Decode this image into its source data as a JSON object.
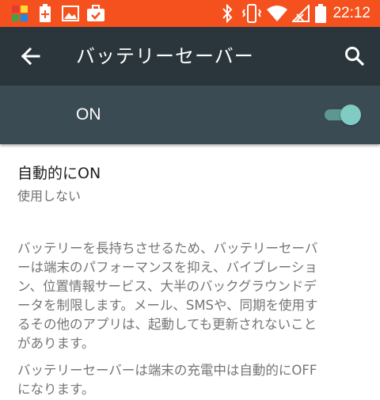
{
  "status_bar": {
    "time": "22:12",
    "background": "#f4511e",
    "left_icons": [
      "app-grid-icon",
      "battery-plus-icon",
      "image-icon",
      "briefcase-icon"
    ],
    "right_icons": [
      "bluetooth-icon",
      "vibrate-icon",
      "wifi-icon",
      "no-signal-icon",
      "battery-icon"
    ]
  },
  "app_bar": {
    "title": "バッテリーセーバー",
    "back_icon": "arrow-left-icon",
    "search_icon": "search-icon",
    "background": "#2b363c"
  },
  "master_switch": {
    "label": "ON",
    "checked": true,
    "background": "#3b4b53",
    "accent": "#80cbc4"
  },
  "auto_on": {
    "title": "自動的にON",
    "value": "使用しない"
  },
  "description": {
    "paragraph1_lines": [
      "バッテリーを長持ちさせるため、バッテリーセーバ",
      "ーは端末のパフォーマンスを抑え、バイブレーショ",
      "ン、位置情報サービス、大半のバックグラウンドデ",
      "ータを制限します。メール、SMSや、同期を使用す",
      "るその他のアプリは、起動しても更新されないこと",
      "があります。"
    ],
    "paragraph2_lines": [
      "バッテリーセーバーは端末の充電中は自動的にOFF",
      "になります。"
    ]
  }
}
